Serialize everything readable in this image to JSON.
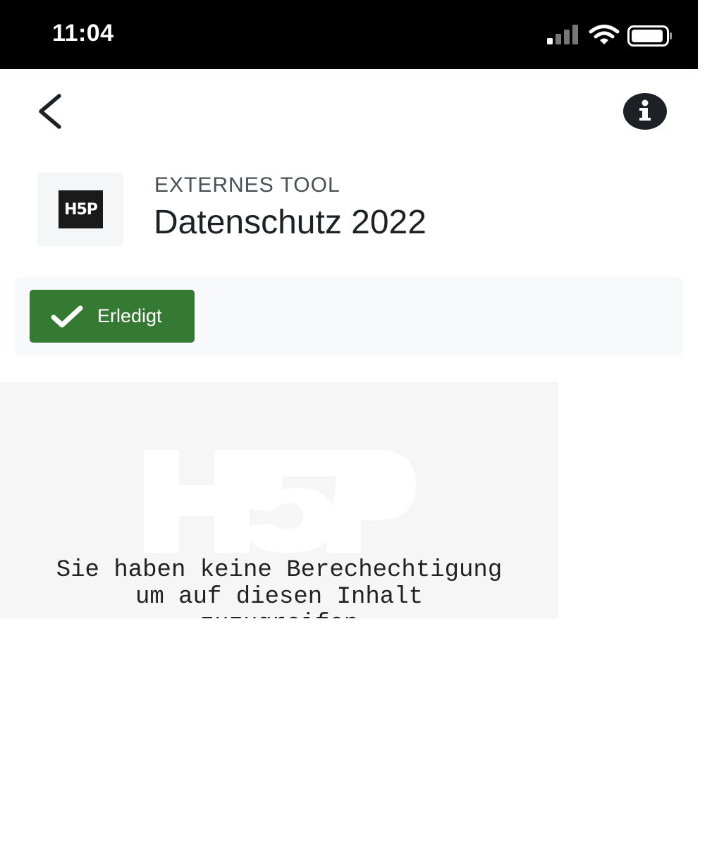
{
  "status_bar": {
    "time": "11:04"
  },
  "nav": {
    "back_icon": "chevron-left-icon",
    "info_icon": "info-icon"
  },
  "tool": {
    "logo_text": "H5P",
    "type_label": "EXTERNES TOOL",
    "title": "Datenschutz 2022"
  },
  "completion": {
    "label": "Erledigt",
    "icon": "check-icon",
    "color": "#357a32"
  },
  "content": {
    "message": "Sie haben keine Berechechtigung\num auf diesen Inhalt\nzuzugreifen"
  }
}
